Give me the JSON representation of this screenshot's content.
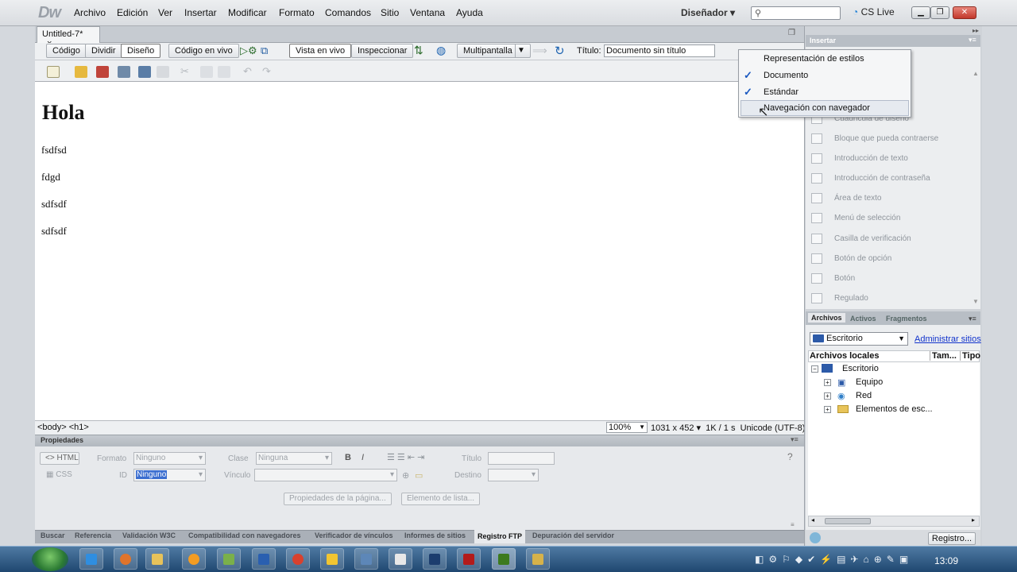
{
  "menubar": {
    "logo": "Dw",
    "items": [
      "Archivo",
      "Edición",
      "Ver",
      "Insertar",
      "Modificar",
      "Formato",
      "Comandos",
      "Sitio",
      "Ventana",
      "Ayuda"
    ],
    "workspace": "Diseñador",
    "cslive": "CS Live"
  },
  "document": {
    "tab_label": "Untitled-7*",
    "close": "×"
  },
  "toolbar": {
    "code": "Código",
    "split": "Dividir",
    "design": "Diseño",
    "live_code": "Código en vivo",
    "live_view": "Vista en vivo",
    "inspect": "Inspeccionar",
    "multiscreen": "Multipantalla",
    "title_label": "Título:",
    "title_value": "Documento sin título"
  },
  "content": {
    "heading": "Hola",
    "paragraphs": [
      "fsdfsd",
      "fdgd",
      "sdfsdf",
      "sdfsdf"
    ]
  },
  "status": {
    "tags": "<body> <h1>",
    "zoom": "100%",
    "size": "1031 x 452",
    "weight": "1K / 1 s",
    "encoding": "Unicode (UTF-8)"
  },
  "properties": {
    "title": "Propiedades",
    "html": "HTML",
    "css": "CSS",
    "format_label": "Formato",
    "format_value": "Ninguno",
    "class_label": "Clase",
    "class_value": "Ninguna",
    "id_label": "ID",
    "id_value": "Ninguno",
    "link_label": "Vínculo",
    "title_label": "Título",
    "target_label": "Destino",
    "page_props": "Propiedades de la página...",
    "list_item": "Elemento de lista..."
  },
  "results_tabs": [
    "Buscar",
    "Referencia",
    "Validación W3C",
    "Compatibilidad con navegadores",
    "Verificador de vínculos",
    "Informes de sitios",
    "Registro FTP",
    "Depuración del servidor"
  ],
  "insert_panel": {
    "title": "Insertar",
    "items": [
      "Cuadricula de diseño",
      "Bloque que pueda contraerse",
      "Introducción de texto",
      "Introducción de contraseña",
      "Área de texto",
      "Menú de selección",
      "Casilla de verificación",
      "Botón de opción",
      "Botón",
      "Regulado"
    ]
  },
  "files_panel": {
    "tabs": [
      "Archivos",
      "Activos",
      "Fragmentos"
    ],
    "site": "Escritorio",
    "manage": "Administrar sitios",
    "columns": [
      "Archivos locales",
      "Tam...",
      "Tipo"
    ],
    "tree": {
      "root": "Escritorio",
      "children": [
        "Equipo",
        "Red",
        "Elementos de esc..."
      ]
    },
    "log_button": "Registro..."
  },
  "dropdown": {
    "items": [
      "Representación de estilos",
      "Documento",
      "Estándar",
      "Navegación con navegador"
    ]
  },
  "taskbar": {
    "clock": "13:09"
  }
}
